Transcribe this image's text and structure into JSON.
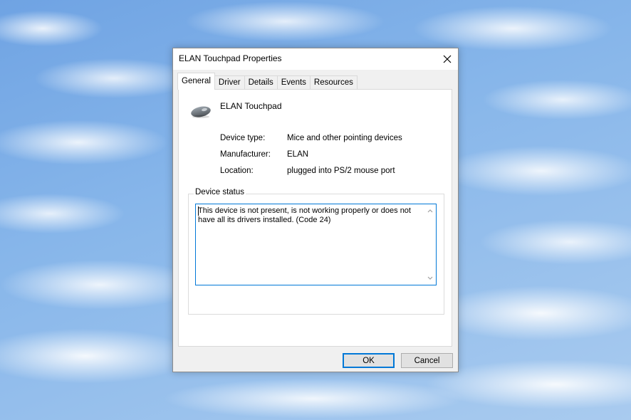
{
  "dialog": {
    "title": "ELAN Touchpad Properties"
  },
  "tabs": [
    {
      "label": "General",
      "active": true
    },
    {
      "label": "Driver"
    },
    {
      "label": "Details"
    },
    {
      "label": "Events"
    },
    {
      "label": "Resources"
    }
  ],
  "device": {
    "name": "ELAN Touchpad",
    "icon": "mouse-icon"
  },
  "properties": {
    "device_type_label": "Device type:",
    "device_type_value": "Mice and other pointing devices",
    "manufacturer_label": "Manufacturer:",
    "manufacturer_value": "ELAN",
    "location_label": "Location:",
    "location_value": "plugged into PS/2 mouse port"
  },
  "device_status": {
    "legend": "Device status",
    "text": "This device is not present, is not working properly or does not have all its drivers installed. (Code 24)"
  },
  "buttons": {
    "ok": "OK",
    "cancel": "Cancel"
  },
  "colors": {
    "accent": "#0078d7",
    "dialog_bg": "#f0f0f0",
    "panel_bg": "#ffffff"
  }
}
